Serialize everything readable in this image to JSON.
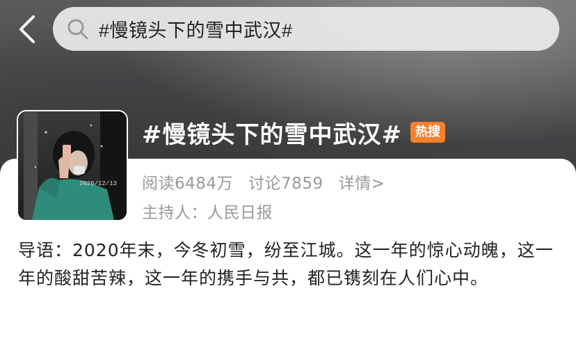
{
  "search": {
    "query": "#慢镜头下的雪中武汉#"
  },
  "topic": {
    "title": "#慢镜头下的雪中武汉#",
    "badge": "热搜",
    "thumbnail_stamp": "2020/12/13",
    "stats": {
      "reads": "阅读6484万",
      "discussions": "讨论7859",
      "details": "详情>"
    },
    "host": "主持人：人民日报",
    "intro": "导语：2020年末，今冬初雪，纷至江城。这一年的惊心动魄，这一年的酸甜苦辣，这一年的携手与共，都已镌刻在人们心中。"
  },
  "colors": {
    "badge": "#f5812c",
    "meta_text": "#9a9a9a",
    "body_text": "#222222"
  }
}
